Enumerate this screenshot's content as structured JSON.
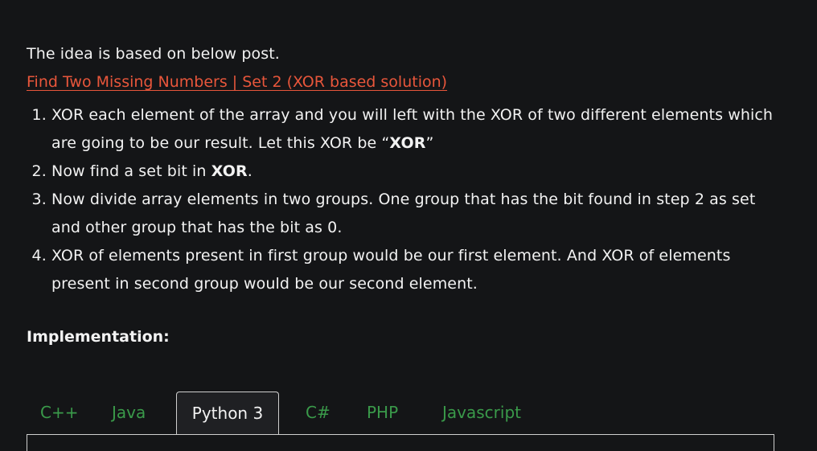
{
  "intro": {
    "text": "The idea is based on below post.",
    "link_text": "Find Two Missing Numbers | Set 2 (XOR based solution)"
  },
  "steps": [
    {
      "pre": "XOR each element of the array and you will left with the XOR of two different elements which are going to be our result. Let this XOR be “",
      "bold": "XOR",
      "post": "”"
    },
    {
      "pre": "Now find a set bit in ",
      "bold": "XOR",
      "post": "."
    },
    {
      "pre": "Now divide array elements in two groups. One group that has the bit found in step 2 as set and other group that has the bit as 0.",
      "bold": "",
      "post": ""
    },
    {
      "pre": "XOR of elements present in first group would be our first element. And XOR of elements present in second group would be our second element.",
      "bold": "",
      "post": ""
    }
  ],
  "implementation_heading": "Implementation:",
  "tabs": [
    {
      "label": "C++",
      "active": false
    },
    {
      "label": "Java",
      "active": false
    },
    {
      "label": "Python 3",
      "active": true
    },
    {
      "label": "C#",
      "active": false
    },
    {
      "label": "PHP",
      "active": false
    },
    {
      "label": "Javascript",
      "active": false
    }
  ],
  "colors": {
    "background": "#141517",
    "text": "#f2f2f2",
    "link": "#e8563b",
    "tab_inactive": "#3a9a4a"
  }
}
